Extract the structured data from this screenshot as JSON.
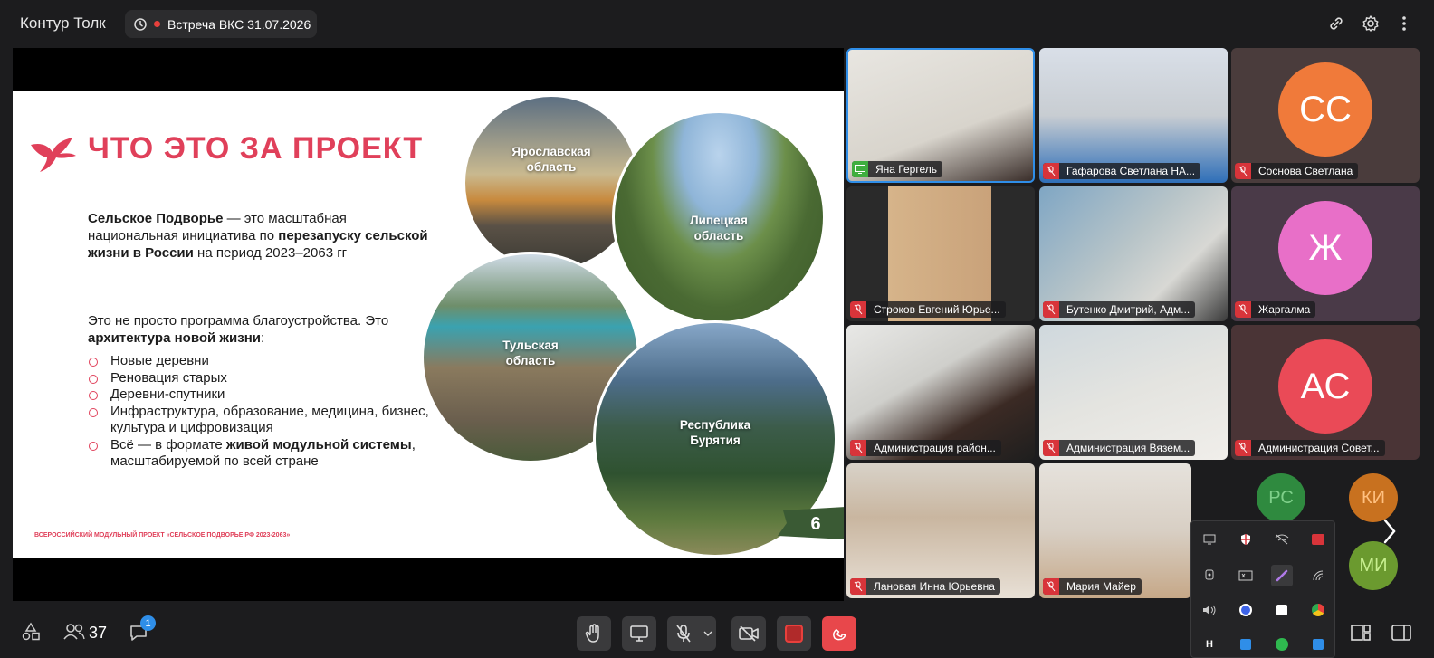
{
  "app": {
    "title": "Контур Толк"
  },
  "meeting": {
    "title": "Встреча ВКС 31.07.2026"
  },
  "slide": {
    "title": "ЧТО ЭТО ЗА ПРОЕКТ",
    "lead_bold1": "Сельское Подворье",
    "lead_text1": " — это масштабная национальная инициатива по ",
    "lead_bold2": "перезапуску сельской жизни в России",
    "lead_text2": " на период 2023–2063 гг",
    "p2_text": "Это не просто программа благоустройства. Это ",
    "p2_bold": "архитектура новой жизни",
    "p2_end": ":",
    "list": [
      "Новые деревни",
      "Реновация старых",
      "Деревни-спутники",
      "Инфраструктура, образование, медицина, бизнес, культура и цифровизация"
    ],
    "last_item_text1": "Всё — в формате ",
    "last_item_bold": "живой модульной системы",
    "last_item_text2": ", масштабируемой по всей стране",
    "regions": [
      "Ярославская область",
      "Липецкая область",
      "Тульская область",
      "Республика Бурятия"
    ],
    "footer": "ВСЕРОССИЙСКИЙ МОДУЛЬНЫЙ ПРОЕКТ «СЕЛЬСКОЕ ПОДВОРЬЕ РФ 2023-2063»",
    "page_number": "6"
  },
  "participants": [
    {
      "name": "Яна Гергель",
      "status": "screen-share"
    },
    {
      "name": "Гафарова Светлана НА...",
      "status": "muted"
    },
    {
      "name": "Соснова Светлана",
      "status": "muted",
      "initials": "СС",
      "color": "#f07a3a"
    },
    {
      "name": "Строков Евгений Юрье...",
      "status": "muted"
    },
    {
      "name": "Бутенко Дмитрий, Адм...",
      "status": "muted"
    },
    {
      "name": "Жаргалма",
      "status": "muted",
      "initials": "Ж",
      "color": "#e86fc8"
    },
    {
      "name": "Администрация район...",
      "status": "muted"
    },
    {
      "name": "Администрация Вязем...",
      "status": "muted"
    },
    {
      "name": "Администрация Совет...",
      "status": "muted",
      "initials": "АС",
      "color": "#ea4a57"
    },
    {
      "name": "Лановая Инна Юрьевна",
      "status": "muted"
    },
    {
      "name": "Мария Майер",
      "status": "muted"
    }
  ],
  "mini_avatars": [
    {
      "initials": "РС",
      "color": "#2f8a3f"
    },
    {
      "initials": "КИ",
      "color": "#c8711f"
    },
    {
      "initials": "МИ",
      "color": "#6b9a2f"
    }
  ],
  "bottom": {
    "participants_count": "37",
    "chat_badge": "1"
  },
  "tray_icons": [
    "display-icon",
    "shield-icon",
    "wifi-off-icon",
    "record-icon",
    "webcam-icon",
    "keyboard-icon",
    "pen-icon",
    "signal-icon",
    "speaker-icon",
    "app-icon",
    "app-icon",
    "chrome-icon",
    "app-icon",
    "app-icon",
    "whatsapp-icon",
    "app-icon"
  ]
}
